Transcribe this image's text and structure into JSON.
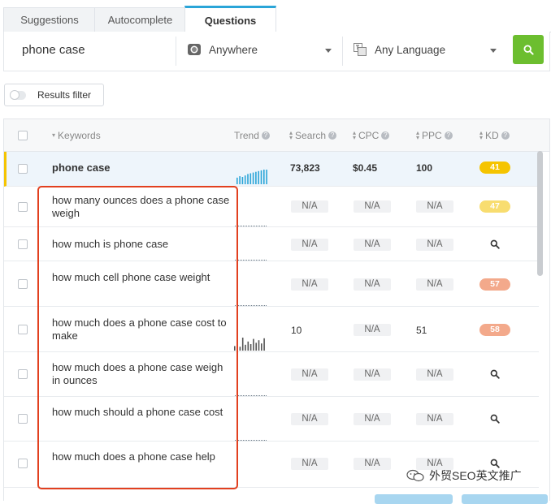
{
  "tabs": [
    {
      "label": "Suggestions"
    },
    {
      "label": "Autocomplete"
    },
    {
      "label": "Questions"
    }
  ],
  "search": {
    "query": "phone case",
    "location": "Anywhere",
    "language": "Any Language"
  },
  "filter": {
    "label": "Results filter"
  },
  "columns": {
    "keywords": "Keywords",
    "trend": "Trend",
    "search": "Search",
    "cpc": "CPC",
    "ppc": "PPC",
    "kd": "KD"
  },
  "rows": [
    {
      "keyword": "phone case",
      "search": "73,823",
      "cpc": "$0.45",
      "ppc": "100",
      "kd": "41"
    },
    {
      "keyword": "how many ounces does a phone case weigh",
      "search": "N/A",
      "cpc": "N/A",
      "ppc": "N/A",
      "kd": "47"
    },
    {
      "keyword": "how much is phone case",
      "search": "N/A",
      "cpc": "N/A",
      "ppc": "N/A",
      "kd": ""
    },
    {
      "keyword": "how much cell phone case weight",
      "search": "N/A",
      "cpc": "N/A",
      "ppc": "N/A",
      "kd": "57"
    },
    {
      "keyword": "how much does a phone case cost to make",
      "search": "10",
      "cpc": "N/A",
      "ppc": "51",
      "kd": "58"
    },
    {
      "keyword": "how much does a phone case weigh in ounces",
      "search": "N/A",
      "cpc": "N/A",
      "ppc": "N/A",
      "kd": ""
    },
    {
      "keyword": "how much should a phone case cost",
      "search": "N/A",
      "cpc": "N/A",
      "ppc": "N/A",
      "kd": ""
    },
    {
      "keyword": "how much does a phone case help",
      "search": "N/A",
      "cpc": "N/A",
      "ppc": "N/A",
      "kd": ""
    }
  ],
  "trend_bars": {
    "phone_case": [
      0.45,
      0.55,
      0.5,
      0.6,
      0.7,
      0.75,
      0.8,
      0.85,
      0.9,
      0.95,
      1.0,
      1.0
    ],
    "cost_to_make": [
      0.35,
      0.6,
      0.3,
      1.0,
      0.45,
      0.7,
      0.5,
      0.9,
      0.6,
      0.8,
      0.55,
      0.95
    ]
  },
  "colors": {
    "accent_tab": "#2aa5d8",
    "search_button": "#6cbe2f",
    "kd_41": "#f5c400",
    "kd_47": "#f8dd70",
    "kd_57": "#f3a98b",
    "kd_58": "#f3a98b",
    "highlight": "#e2401f"
  },
  "watermark": {
    "text": "外贸SEO英文推广"
  }
}
